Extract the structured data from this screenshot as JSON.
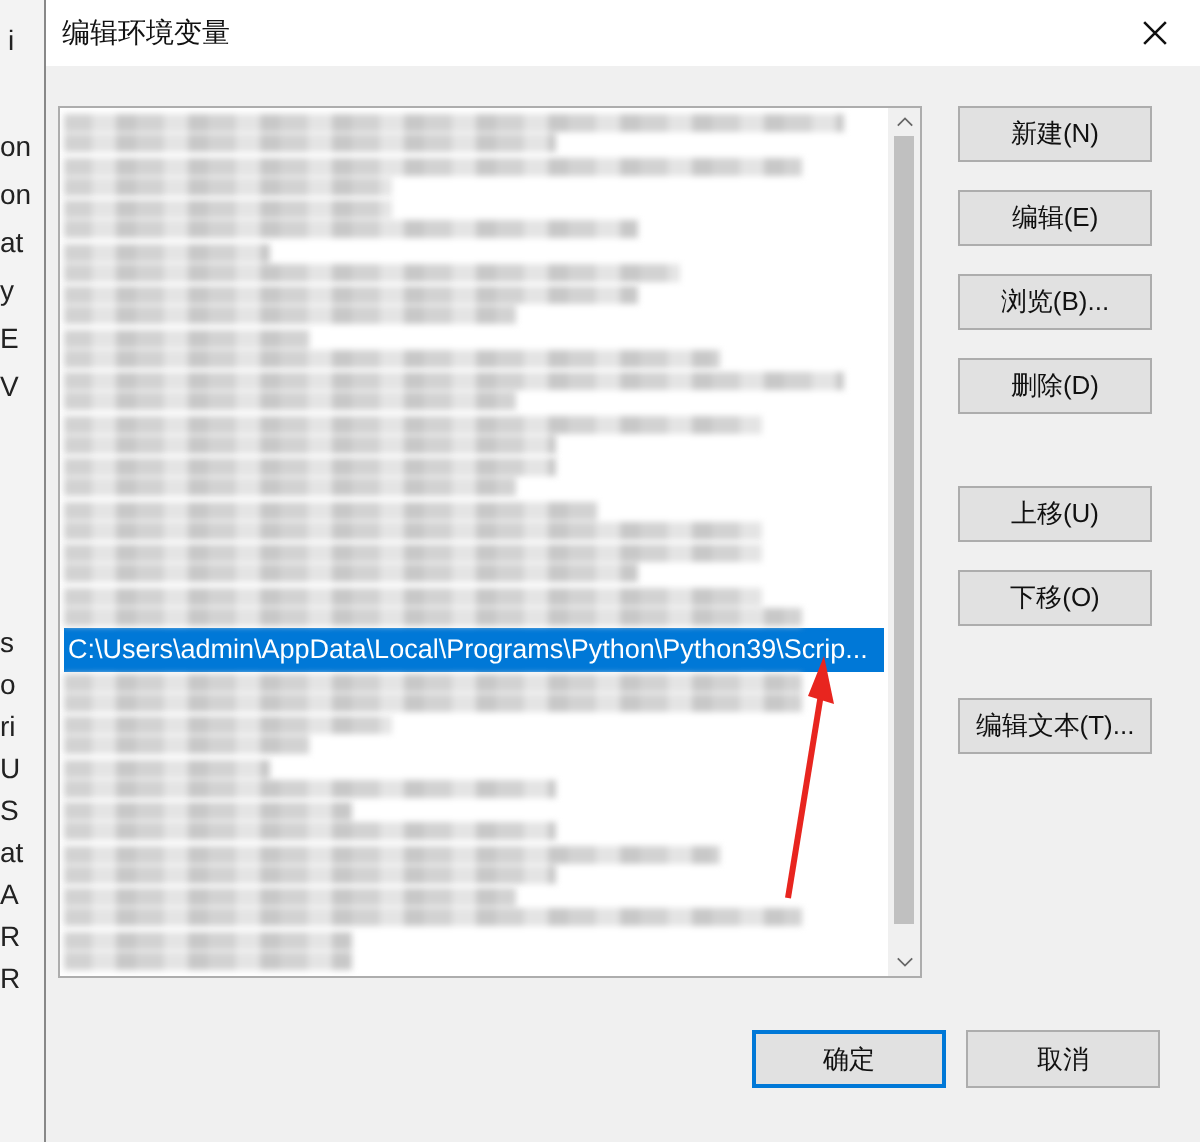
{
  "background_window": {
    "title": "i",
    "items": [
      "on",
      "on",
      "at",
      "y",
      "E",
      "V"
    ],
    "items_lower": [
      "s",
      "o",
      "ri",
      "U",
      "S",
      "at",
      "A",
      "R",
      "R"
    ]
  },
  "window": {
    "title": "编辑环境变量"
  },
  "list": {
    "items": [
      {
        "kind": "redacted",
        "selected": false
      },
      {
        "kind": "redacted",
        "selected": false
      },
      {
        "kind": "redacted",
        "selected": false
      },
      {
        "kind": "redacted",
        "selected": false
      },
      {
        "kind": "redacted",
        "selected": false
      },
      {
        "kind": "redacted",
        "selected": false
      },
      {
        "kind": "redacted",
        "selected": false
      },
      {
        "kind": "redacted",
        "selected": false
      },
      {
        "kind": "redacted",
        "selected": false
      },
      {
        "kind": "redacted",
        "selected": false
      },
      {
        "kind": "redacted",
        "selected": false
      },
      {
        "kind": "redacted",
        "selected": false
      },
      {
        "kind": "path",
        "text": "C:\\Users\\admin\\AppData\\Local\\Programs\\Python\\Python39\\Scrip...",
        "selected": true
      },
      {
        "kind": "redacted",
        "selected": false
      },
      {
        "kind": "redacted",
        "selected": false
      },
      {
        "kind": "redacted",
        "selected": false
      },
      {
        "kind": "redacted",
        "selected": false
      },
      {
        "kind": "redacted",
        "selected": false
      },
      {
        "kind": "redacted",
        "selected": false
      },
      {
        "kind": "redacted",
        "selected": false
      }
    ]
  },
  "side_button_groups": [
    [
      "新建(N)",
      "编辑(E)",
      "浏览(B)...",
      "删除(D)"
    ],
    [
      "上移(U)",
      "下移(O)"
    ],
    [
      "编辑文本(T)..."
    ]
  ],
  "footer_buttons": [
    {
      "label": "确定",
      "default": true
    },
    {
      "label": "取消",
      "default": false
    }
  ]
}
